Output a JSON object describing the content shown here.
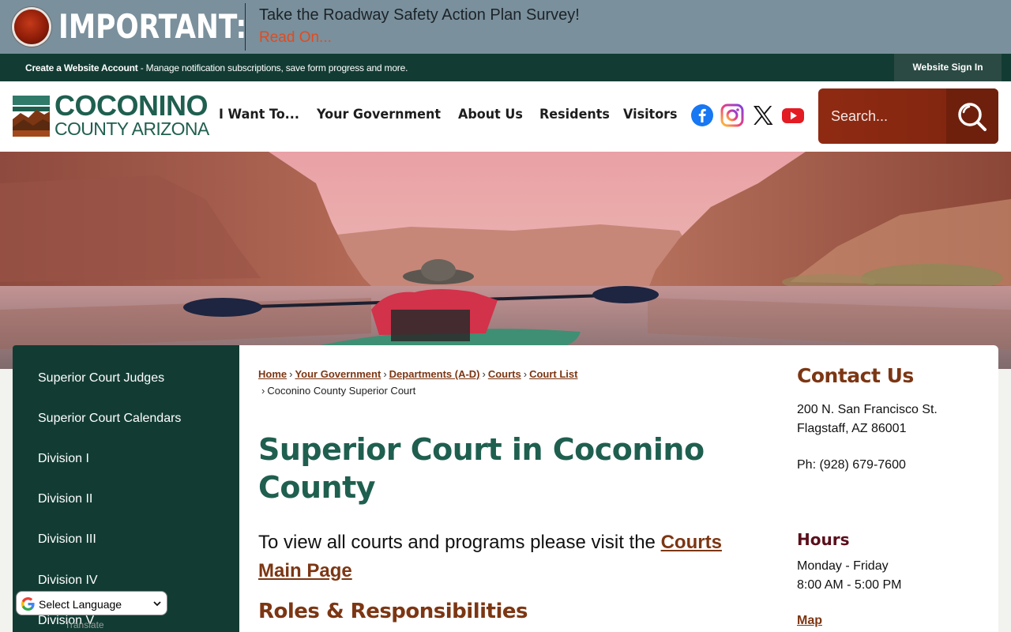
{
  "alert": {
    "label": "IMPORTANT:",
    "title": "Take the Roadway Safety Action Plan Survey!",
    "link": "Read On..."
  },
  "account_bar": {
    "create_link": "Create a Website Account",
    "description": " - Manage notification subscriptions, save form progress and more.",
    "sign_in": "Website Sign In"
  },
  "logo": {
    "line1": "COCONINO",
    "line2": "COUNTY ARIZONA"
  },
  "nav": {
    "items": [
      "I Want To...",
      "Your Government",
      "About Us",
      "Residents",
      "Visitors"
    ]
  },
  "social": [
    "facebook-icon",
    "instagram-icon",
    "x-icon",
    "youtube-icon"
  ],
  "search": {
    "placeholder": "Search..."
  },
  "sidebar": {
    "items": [
      "Superior Court Judges",
      "Superior Court Calendars",
      "Division I",
      "Division II",
      "Division III",
      "Division IV",
      "Division V"
    ]
  },
  "breadcrumb": {
    "links": [
      "Home",
      "Your Government",
      "Departments (A-D)",
      "Courts",
      "Court List"
    ],
    "current": "Coconino County Superior Court"
  },
  "main": {
    "title": "Superior Court in Coconino County",
    "intro_text": "To view all courts and programs please visit the ",
    "intro_link": "Courts Main Page",
    "section_title": "Roles & Responsibilities"
  },
  "contact": {
    "title": "Contact Us",
    "address1": "200 N. San Francisco St.",
    "address2": "Flagstaff, AZ 86001",
    "phone": "Ph: (928) 679-7600",
    "hours_title": "Hours",
    "hours_days": "Monday - Friday",
    "hours_time": "8:00 AM - 5:00 PM",
    "map_link": "Map"
  },
  "translate": {
    "label": "Select Language",
    "footer": "Translate"
  },
  "colors": {
    "dark_green": "#123c33",
    "brand_green": "#1f5f4f",
    "rust": "#7c3613",
    "alert_bg": "#7a909c"
  }
}
